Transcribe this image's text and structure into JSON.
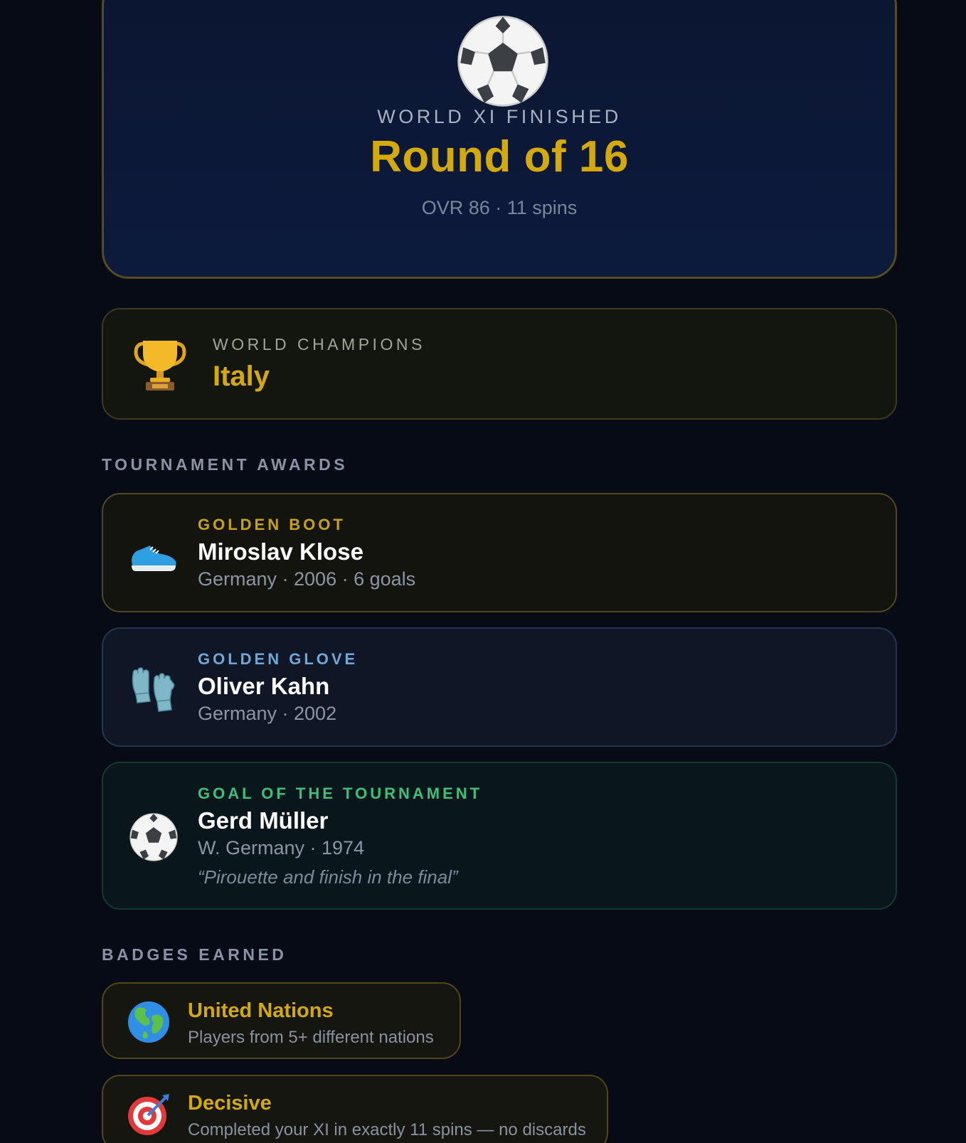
{
  "colors": {
    "background": "#060b16",
    "gold": "#d4a90a",
    "glove_blue": "#6fa8d8",
    "goal_green": "#3fc078"
  },
  "hero": {
    "icon": "soccer-ball-icon",
    "kicker": "WORLD XI FINISHED",
    "title": "Round of 16",
    "subtitle": "OVR 86 · 11 spins"
  },
  "champions": {
    "icon": "trophy-icon",
    "kicker": "WORLD CHAMPIONS",
    "name": "Italy"
  },
  "awards": {
    "section_title": "TOURNAMENT AWARDS",
    "items": [
      {
        "icon": "running-shoe-icon",
        "kicker": "GOLDEN BOOT",
        "player": "Miroslav Klose",
        "meta": "Germany · 2006 · 6 goals"
      },
      {
        "icon": "gloves-icon",
        "kicker": "GOLDEN GLOVE",
        "player": "Oliver Kahn",
        "meta": "Germany · 2002"
      },
      {
        "icon": "soccer-ball-icon",
        "kicker": "GOAL OF THE TOURNAMENT",
        "player": "Gerd Müller",
        "meta": "W. Germany · 1974",
        "quote": "“Pirouette and finish in the final”"
      }
    ]
  },
  "badges": {
    "section_title": "BADGES EARNED",
    "items": [
      {
        "icon": "globe-icon",
        "name": "United Nations",
        "desc": "Players from 5+ different nations"
      },
      {
        "icon": "target-icon",
        "name": "Decisive",
        "desc": "Completed your XI in exactly 11 spins — no discards"
      }
    ]
  }
}
